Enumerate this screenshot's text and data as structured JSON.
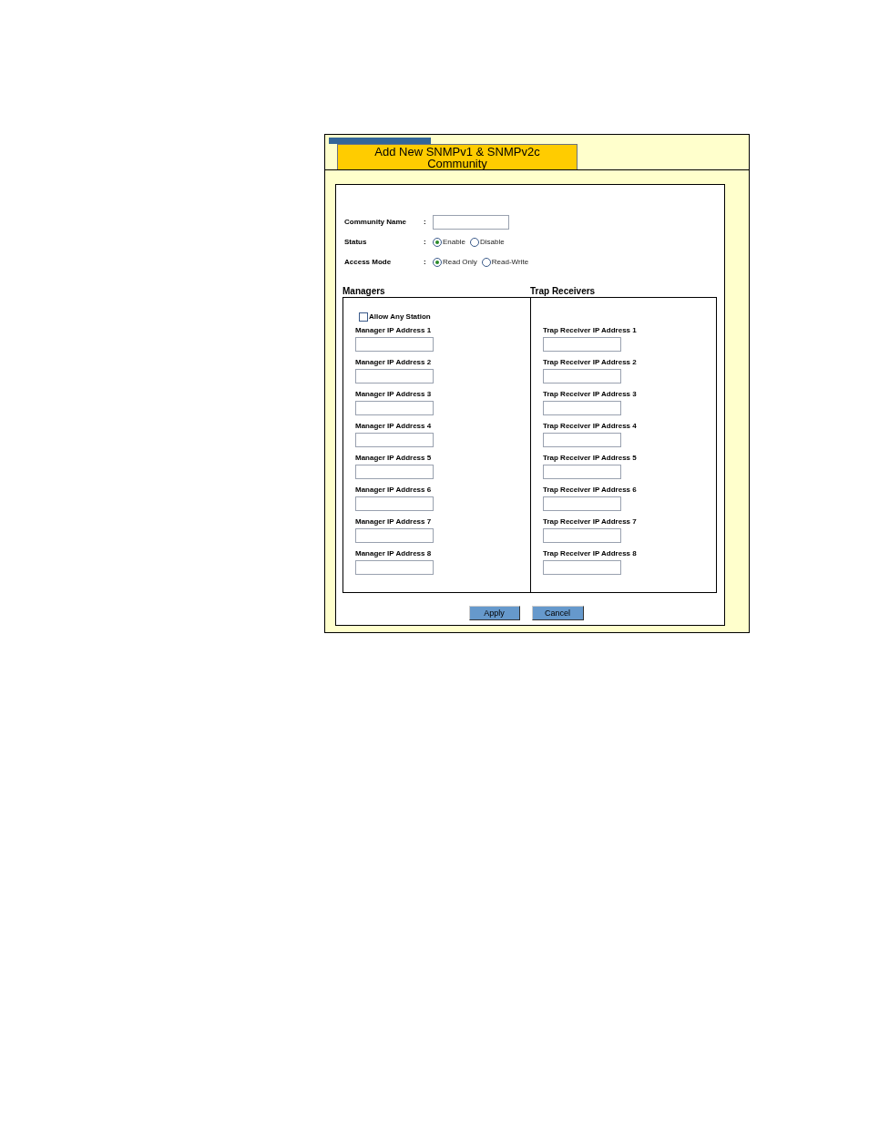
{
  "panel": {
    "title": "Add New SNMPv1 & SNMPv2c Community"
  },
  "form": {
    "community_name": {
      "label": "Community Name",
      "separator": ":"
    },
    "status": {
      "label": "Status",
      "separator": ":",
      "options": [
        {
          "label": "Enable",
          "selected": true
        },
        {
          "label": "Disable",
          "selected": false
        }
      ]
    },
    "access_mode": {
      "label": "Access Mode",
      "separator": ":",
      "options": [
        {
          "label": "Read Only",
          "selected": true
        },
        {
          "label": "Read-Write",
          "selected": false
        }
      ]
    }
  },
  "managers": {
    "heading": "Managers",
    "allow_any_station": {
      "label": "Allow Any Station",
      "checked": false
    },
    "fields": [
      "Manager IP Address 1",
      "Manager IP Address 2",
      "Manager IP Address 3",
      "Manager IP Address 4",
      "Manager IP Address 5",
      "Manager IP Address 6",
      "Manager IP Address 7",
      "Manager IP Address 8"
    ]
  },
  "trap_receivers": {
    "heading": "Trap Receivers",
    "fields": [
      "Trap Receiver IP Address 1",
      "Trap Receiver IP Address 2",
      "Trap Receiver IP Address 3",
      "Trap Receiver IP Address 4",
      "Trap Receiver IP Address 5",
      "Trap Receiver IP Address 6",
      "Trap Receiver IP Address 7",
      "Trap Receiver IP Address 8"
    ]
  },
  "buttons": [
    "Apply",
    "Cancel"
  ]
}
